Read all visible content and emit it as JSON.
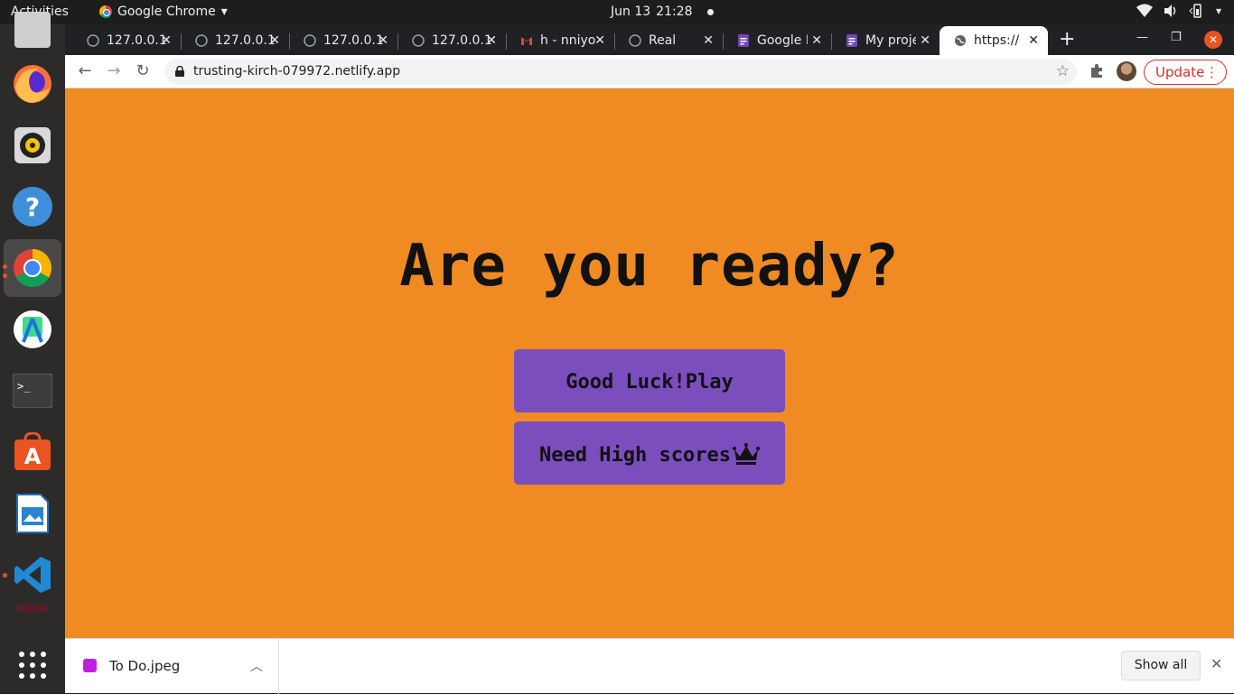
{
  "system": {
    "activities": "Activities",
    "app_menu": "Google Chrome",
    "date": "Jun 13",
    "time": "21:28"
  },
  "browser": {
    "tabs": [
      {
        "title": "127.0.0.1",
        "icon": "globe-icon"
      },
      {
        "title": "127.0.0.1",
        "icon": "globe-icon"
      },
      {
        "title": "127.0.0.1",
        "icon": "globe-icon"
      },
      {
        "title": "127.0.0.1",
        "icon": "globe-icon"
      },
      {
        "title": "h - nniyo",
        "icon": "gmail-icon"
      },
      {
        "title": "Real",
        "icon": "globe-icon"
      },
      {
        "title": "Google Forms",
        "icon": "forms-icon"
      },
      {
        "title": "My project",
        "icon": "forms-icon"
      },
      {
        "title": "https://",
        "icon": "globe-icon",
        "active": true
      }
    ],
    "url": "trusting-kirch-079972.netlify.app",
    "update_label": "Update",
    "accent": "#d93025"
  },
  "page": {
    "headline": "Are you ready?",
    "play_label": "Good Luck!Play",
    "scores_label": "Need High scores",
    "background": "#ef8b22",
    "button_color": "#7b4dbd"
  },
  "downloads": {
    "file_name": "To Do.jpeg",
    "show_all_label": "Show all"
  },
  "dock": [
    "firefox-icon",
    "rhythmbox-icon",
    "help-icon",
    "chrome-icon",
    "android-studio-icon",
    "terminal-icon",
    "software-center-icon",
    "writer-icon",
    "vscode-icon",
    "show-apps-icon"
  ]
}
